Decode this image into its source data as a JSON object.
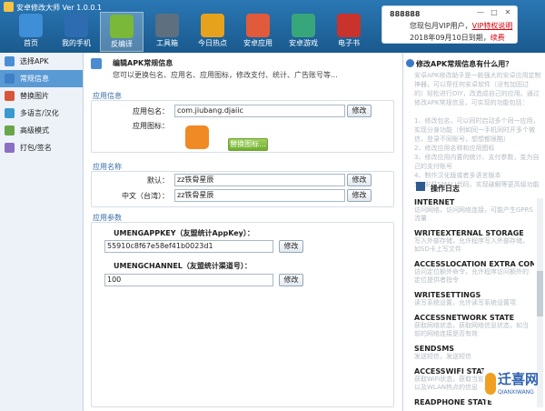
{
  "app": {
    "title": "安卓修改大师 Ver 1.0.0.1"
  },
  "colors": {
    "titlebar": "#1d5f93",
    "accent": "#5a9ad4",
    "red": "#d8000c",
    "green": "#6fae2d"
  },
  "toolbar": {
    "items": [
      {
        "label": "首页",
        "icon": "home-icon",
        "color": "#3f8ed8"
      },
      {
        "label": "我的手机",
        "icon": "phone-icon",
        "color": "#2e6cb1"
      },
      {
        "label": "反编译",
        "icon": "android-icon",
        "color": "#79b838"
      },
      {
        "label": "工具箱",
        "icon": "toolbox-icon",
        "color": "#5e6f80"
      },
      {
        "label": "今日热点",
        "icon": "star-icon",
        "color": "#e6a21c"
      },
      {
        "label": "安卓应用",
        "icon": "apps-icon",
        "color": "#e05a3b"
      },
      {
        "label": "安卓游戏",
        "icon": "game-icon",
        "color": "#37a67a"
      },
      {
        "label": "电子书",
        "icon": "book-icon",
        "color": "#c9332b"
      }
    ]
  },
  "user": {
    "name": "888888",
    "vip_prefix": "您现包月VIP用户，",
    "vip_link": "VIP特权说明",
    "expire_prefix": "2018年09月10日到期，",
    "renew_link": "续费"
  },
  "sidebar": {
    "items": [
      {
        "label": "选择APK",
        "icon": "select-apk-icon",
        "color": "#4a8fd4"
      },
      {
        "label": "常规信息",
        "icon": "info-icon",
        "color": "#3f7fc6"
      },
      {
        "label": "替换图片",
        "icon": "image-icon",
        "color": "#d9563b"
      },
      {
        "label": "多语言/汉化",
        "icon": "globe-icon",
        "color": "#3a9ad0"
      },
      {
        "label": "高级模式",
        "icon": "advanced-icon",
        "color": "#6aa54a"
      },
      {
        "label": "打包/签名",
        "icon": "package-icon",
        "color": "#8a6fc2"
      }
    ]
  },
  "main": {
    "header_title": "编辑APK常规信息",
    "header_desc": "您可以更换包名、应用名、应用图标，修改支付、统计、广告账号等...",
    "app_info": {
      "section": "应用信息",
      "package_label": "应用包名：",
      "package_value": "com.jiubang.djaiic",
      "icon_label": "应用图标：",
      "modify": "修改",
      "replace_icon": "替换图标..."
    },
    "app_name": {
      "section": "应用名称",
      "default_label": "默认：",
      "default_value": "zz铁骨星辰",
      "zh_tw_label": "中文（台湾）：",
      "zh_tw_value": "zz铁骨星辰",
      "modify": "修改"
    },
    "params": {
      "section": "应用参数",
      "items": [
        {
          "key": "UMENGAPPKEY（友盟统计AppKey）：",
          "value": "55910c8f67e58ef41b0023d1",
          "modify": "修改"
        },
        {
          "key": "UMENGCHANNEL（友盟统计渠道号）：",
          "value": "100",
          "modify": "修改"
        }
      ]
    }
  },
  "help": {
    "title": "修改APK常规信息有什么用？",
    "text": "安卓APK修改助手是一款强大的安卓应用定制\n神器，可以帮任何安卓软件（没有加固过\n的）轻松进行DIY，改造成自己的应用。通过\n修改APK常规信息，可实现的功能包括：\n\n1、修改包名，可以同时启动多个同一应用，\n实现分身功能（例如同一手机同时开多个微\n信，登录不同账号，想想都很酷）\n2、修改应用名称和应用图标\n3、修改应用内置的统计、支付参数，变为自\n己的支付账号\n4、制作汉化版或者多语言版本\n5、安装SMALI代码，实现破解等更高级功能"
  },
  "log": {
    "title": "操作日志",
    "items": [
      {
        "name": "INTERNET",
        "desc": "访问网络，访问网络连接，可能产生GPRS流量"
      },
      {
        "name": "WRITEEXTERNAL STORAGE",
        "desc": "写入外部存储，允许程序写入外部存储，如SD卡上写文件"
      },
      {
        "name": "ACCESSLOCATION EXTRA COMM",
        "desc": "访问定位额外命令，允许程序访问额外的定位提供者指令"
      },
      {
        "name": "WRITESETTINGS",
        "desc": "读写系统设置，允许读写系统设置项"
      },
      {
        "name": "ACCESSNETWORK STATE",
        "desc": "获取网络状态，获取网络信息状态，如当前的网络连接是否有效"
      },
      {
        "name": "SENDSMS",
        "desc": "发送短信，发送短信"
      },
      {
        "name": "ACCESSWIFI STATE",
        "desc": "获取WiFi状态，获取当前WiFi接入的状态以及WLAN热点的信息"
      },
      {
        "name": "READPHONE STATE",
        "desc": ""
      }
    ]
  },
  "watermark": {
    "main": "迁喜网",
    "sub": "QIANXIWANG"
  },
  "window": {
    "controls": [
      "—",
      "□",
      "✕"
    ]
  }
}
